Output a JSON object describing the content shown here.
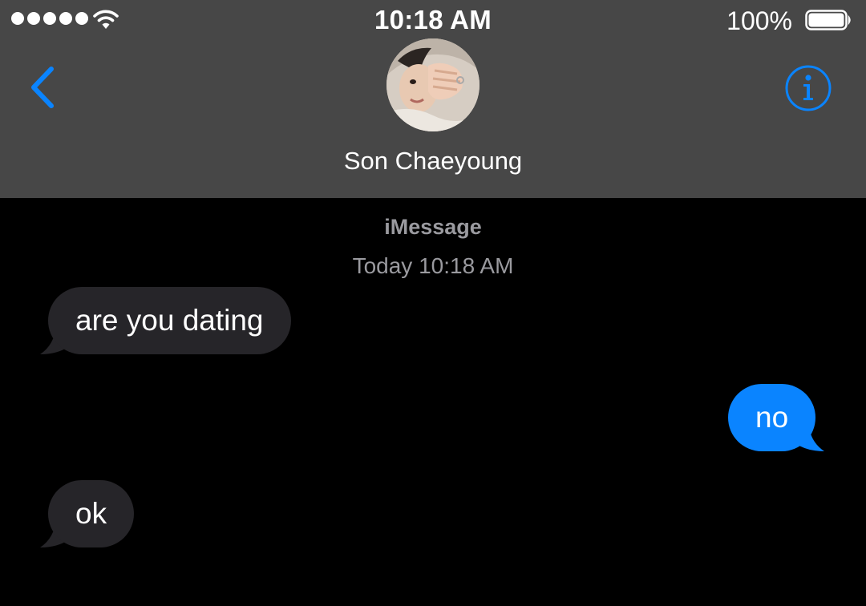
{
  "status_bar": {
    "time": "10:18 AM",
    "battery_percent": "100%",
    "signal_bars": 5,
    "battery_level": 1.0
  },
  "nav": {
    "contact_name": "Son Chaeyoung",
    "back_icon": "chevron-left-icon",
    "info_icon": "info-circle-icon",
    "accent_color": "#0a84ff"
  },
  "conversation": {
    "service": "iMessage",
    "timestamp": "Today 10:18 AM",
    "messages": [
      {
        "direction": "received",
        "text": "are you dating"
      },
      {
        "direction": "sent",
        "text": "no"
      },
      {
        "direction": "received",
        "text": "ok"
      }
    ]
  },
  "colors": {
    "header_bg": "#474747",
    "background": "#000000",
    "received_bubble": "#262529",
    "sent_bubble": "#0a84ff",
    "meta_text": "#9a9a9f"
  }
}
